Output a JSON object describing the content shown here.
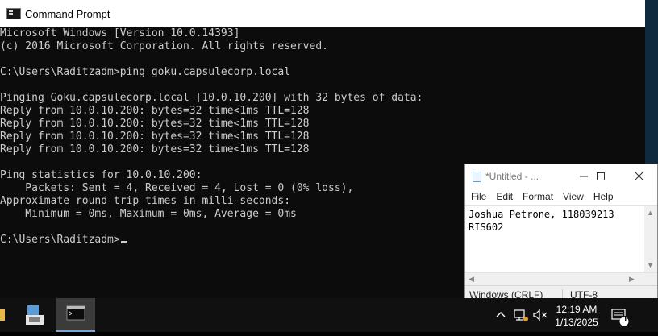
{
  "window": {
    "title": "Command Prompt"
  },
  "console": {
    "lines": [
      "Microsoft Windows [Version 10.0.14393]",
      "(c) 2016 Microsoft Corporation. All rights reserved.",
      "",
      "C:\\Users\\Raditzadm>ping goku.capsulecorp.local",
      "",
      "Pinging Goku.capsulecorp.local [10.0.10.200] with 32 bytes of data:",
      "Reply from 10.0.10.200: bytes=32 time<1ms TTL=128",
      "Reply from 10.0.10.200: bytes=32 time<1ms TTL=128",
      "Reply from 10.0.10.200: bytes=32 time<1ms TTL=128",
      "Reply from 10.0.10.200: bytes=32 time<1ms TTL=128",
      "",
      "Ping statistics for 10.0.10.200:",
      "    Packets: Sent = 4, Received = 4, Lost = 0 (0% loss),",
      "Approximate round trip times in milli-seconds:",
      "    Minimum = 0ms, Maximum = 0ms, Average = 0ms",
      "",
      "C:\\Users\\Raditzadm>"
    ]
  },
  "notepad": {
    "title": "*Untitled - ...",
    "menu": [
      "File",
      "Edit",
      "Format",
      "View",
      "Help"
    ],
    "content": "Joshua Petrone, 118039213\nRIS602",
    "status": {
      "line_ending": "Windows (CRLF)",
      "encoding": "UTF-8"
    }
  },
  "taskbar": {
    "time": "12:19 AM",
    "date": "1/13/2025",
    "notification_count": "1",
    "active_color": "#7aa7d6"
  },
  "icons": [
    "cmd-icon",
    "notepad-icon",
    "minimize-icon",
    "maximize-icon",
    "close-icon",
    "file-explorer-icon",
    "chevron-up-icon",
    "network-icon",
    "volume-muted-icon",
    "action-center-icon"
  ]
}
